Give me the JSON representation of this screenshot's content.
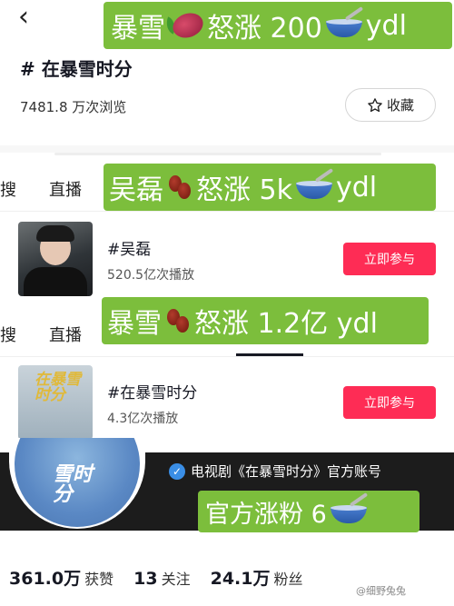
{
  "captions": {
    "c1": {
      "pre": "暴雪",
      "post": "怒涨 200",
      "suffix": "ydl"
    },
    "c2": {
      "pre": "吴磊",
      "post": "怒涨 5k",
      "suffix": "ydl"
    },
    "c3": {
      "pre": "暴雪",
      "post": "怒涨 1.2亿 ydl"
    },
    "c4": {
      "pre": "官方涨粉 6"
    }
  },
  "header": {
    "topic_title": "# 在暴雪时分",
    "views": "7481.8 万次浏览",
    "favorite_label": "收藏"
  },
  "tabs": [
    {
      "search": "搜",
      "live": "直播"
    },
    {
      "search": "搜",
      "live": "直播"
    }
  ],
  "topics": [
    {
      "hashtag": "#吴磊",
      "plays": "520.5亿次播放",
      "join_label": "立即参与"
    },
    {
      "hashtag": "#在暴雪时分",
      "plays": "4.3亿次播放",
      "join_label": "立即参与",
      "thumb_text": "在暴雪时分"
    }
  ],
  "profile": {
    "avatar_text": "雪时分",
    "account_name": "电视剧《在暴雪时分》官方账号"
  },
  "stats": [
    {
      "num": "361.0万",
      "label": "获赞"
    },
    {
      "num": "13",
      "label": "关注"
    },
    {
      "num": "24.1万",
      "label": "粉丝"
    }
  ],
  "watermark": "@细野兔兔"
}
